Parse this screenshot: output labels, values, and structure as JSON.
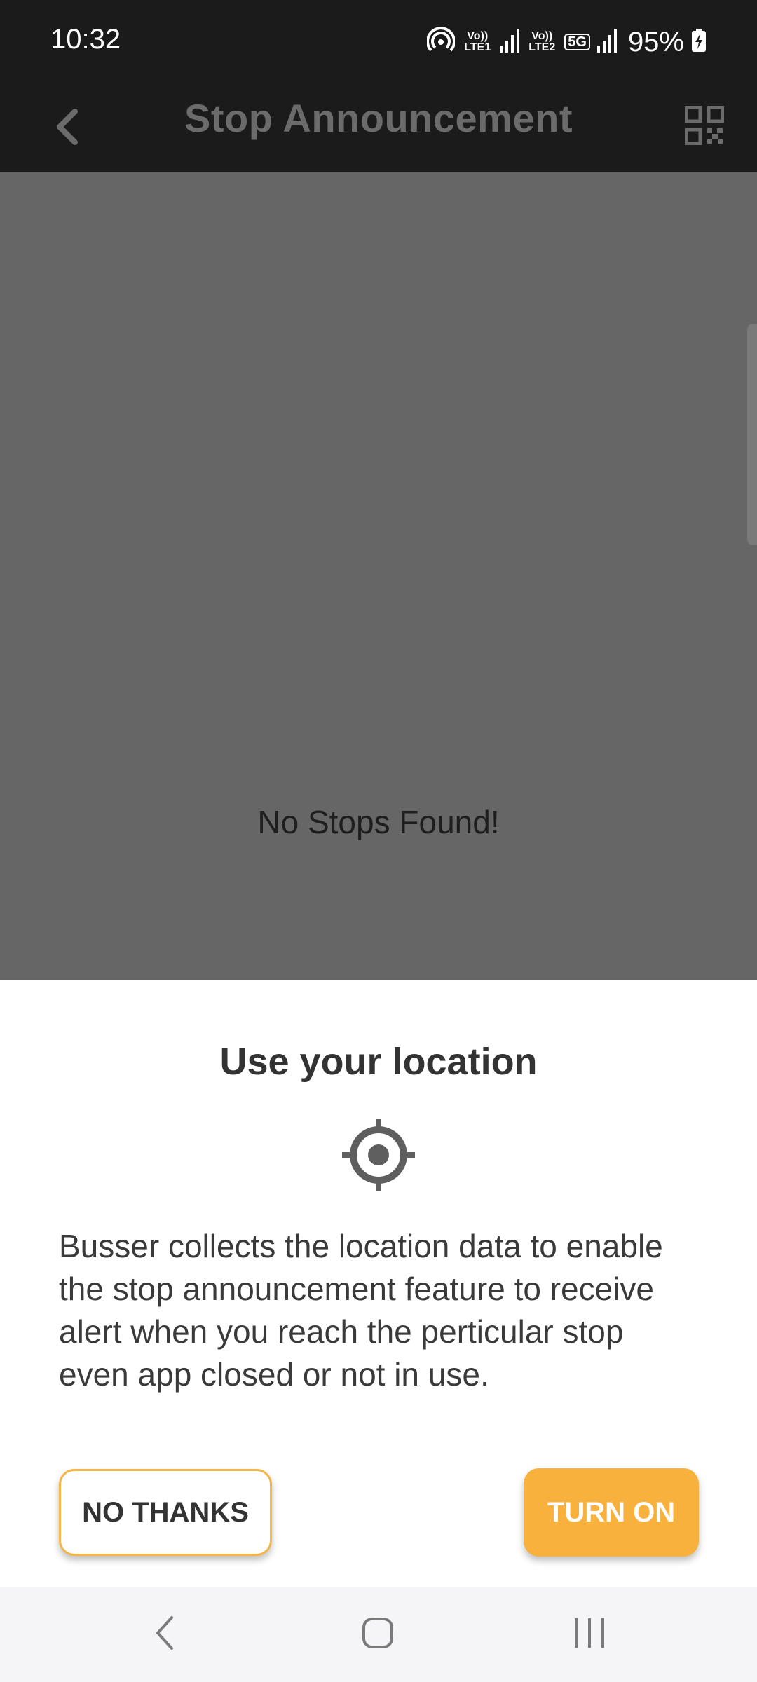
{
  "status_bar": {
    "time": "10:32",
    "net1_label": "Vo)) LTE1",
    "net2_label": "Vo)) LTE2",
    "net2_type": "5G",
    "battery_text": "95%"
  },
  "app_bar": {
    "title": "Stop Announcement"
  },
  "content": {
    "empty_text": "No Stops Found!"
  },
  "location_sheet": {
    "title": "Use your location",
    "icon": "location-target-icon",
    "body": "Busser collects the location data to enable the stop announcement feature to receive alert when you reach the perticular stop even app closed or not in use.",
    "no_thanks_label": "NO THANKS",
    "turn_on_label": "TURN ON"
  },
  "colors": {
    "accent": "#f8b13d",
    "dim_overlay": "#666666",
    "bar_background": "#1b1b1b"
  },
  "icons": [
    "back-arrow-icon",
    "qr-code-icon",
    "hotspot-icon",
    "signal-icon",
    "battery-charging-icon",
    "nav-back-icon",
    "nav-home-icon",
    "nav-recents-icon"
  ]
}
